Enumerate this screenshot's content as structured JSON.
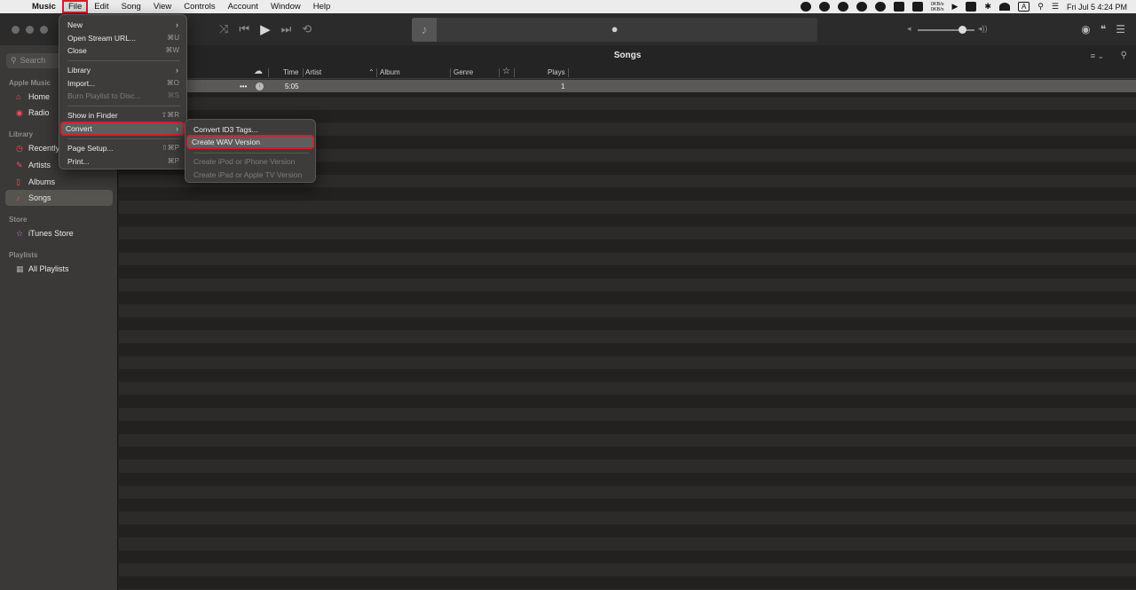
{
  "menubar": {
    "app_name": "Music",
    "menus": [
      "File",
      "Edit",
      "Song",
      "View",
      "Controls",
      "Account",
      "Window",
      "Help"
    ],
    "net_up": "0KB/s",
    "net_down": "0KB/s",
    "input_source": "A",
    "clock": "Fri Jul 5  4:24 PM"
  },
  "sidebar": {
    "search_placeholder": "Search",
    "sections": {
      "apple_music": "Apple Music",
      "library": "Library",
      "store": "Store",
      "playlists": "Playlists"
    },
    "items": {
      "home": "Home",
      "radio": "Radio",
      "recently": "Recently",
      "artists": "Artists",
      "albums": "Albums",
      "songs": "Songs",
      "itunes_store": "iTunes Store",
      "all_playlists": "All Playlists"
    }
  },
  "content": {
    "title": "Songs",
    "columns": {
      "time": "Time",
      "artist": "Artist",
      "album": "Album",
      "genre": "Genre",
      "plays": "Plays"
    },
    "rows": [
      {
        "more": "•••",
        "time": "5:05",
        "plays": "1"
      }
    ]
  },
  "file_menu": {
    "new": "New",
    "open_stream": "Open Stream URL...",
    "open_stream_sc": "⌘U",
    "close": "Close",
    "close_sc": "⌘W",
    "library": "Library",
    "import": "Import...",
    "import_sc": "⌘O",
    "burn": "Burn Playlist to Disc...",
    "burn_sc": "⌘S",
    "show_finder": "Show in Finder",
    "show_finder_sc": "⇧⌘R",
    "convert": "Convert",
    "page_setup": "Page Setup...",
    "page_setup_sc": "⇧⌘P",
    "print": "Print...",
    "print_sc": "⌘P"
  },
  "convert_menu": {
    "id3": "Convert ID3 Tags...",
    "wav": "Create WAV Version",
    "ipod": "Create iPod or iPhone Version",
    "appletv": "Create iPad or Apple TV Version"
  },
  "colors": {
    "accent_red": "#fa4d5e",
    "highlight_box": "#d2202a"
  }
}
